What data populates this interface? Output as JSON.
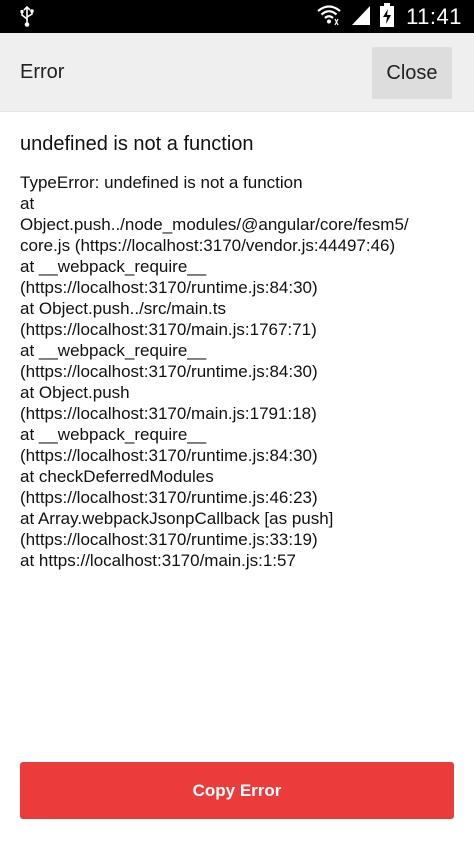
{
  "status_bar": {
    "time": "11:41",
    "icons": [
      "usb-icon",
      "wifi-icon",
      "signal-icon",
      "battery-charging-icon"
    ]
  },
  "header": {
    "title": "Error",
    "close_label": "Close"
  },
  "error": {
    "title": "undefined is not a function",
    "stack_lines": [
      "TypeError: undefined is not a function",
      "at",
      "Object.push../node_modules/@angular/core/fesm5/",
      "core.js (https://localhost:3170/vendor.js:44497:46)",
      "at __webpack_require__",
      "(https://localhost:3170/runtime.js:84:30)",
      "at Object.push../src/main.ts",
      "(https://localhost:3170/main.js:1767:71)",
      "at __webpack_require__",
      "(https://localhost:3170/runtime.js:84:30)",
      "at Object.push",
      "(https://localhost:3170/main.js:1791:18)",
      "at __webpack_require__",
      "(https://localhost:3170/runtime.js:84:30)",
      "at checkDeferredModules",
      "(https://localhost:3170/runtime.js:46:23)",
      "at Array.webpackJsonpCallback [as push]",
      "(https://localhost:3170/runtime.js:33:19)",
      "at https://localhost:3170/main.js:1:57"
    ]
  },
  "actions": {
    "copy_label": "Copy Error"
  },
  "colors": {
    "header_bg": "#efefef",
    "close_bg": "#dddddd",
    "copy_bg": "#ec3b3b",
    "status_bg": "#000000"
  }
}
